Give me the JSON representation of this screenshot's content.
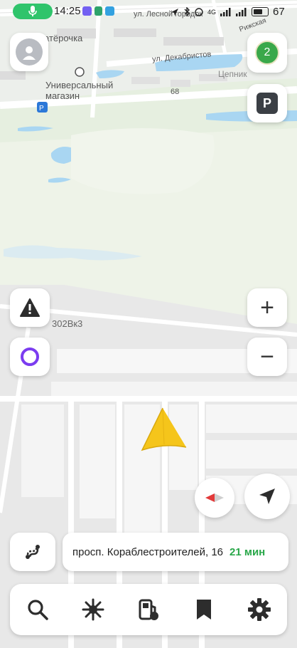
{
  "status_bar": {
    "time": "14:25",
    "network": "4G",
    "battery": "67"
  },
  "map": {
    "labels": {
      "shop": "Универсальный магазин",
      "pyaterochka": "атёрочка",
      "street_lesnoy": "ул. Лесной городок",
      "street_rizhskaya": "Рижская",
      "street_dekabristov": "ул. Декабристов",
      "tsepnik": "Цепник",
      "house_68": "68",
      "building_302": "302Вк3"
    }
  },
  "controls": {
    "notifications_count": "2",
    "parking_label": "P",
    "zoom_in": "+",
    "zoom_out": "−"
  },
  "route": {
    "destination": "просп. Кораблестроителей, 16",
    "eta": "21 мин"
  },
  "colors": {
    "accent_green": "#2aa84a",
    "arrow_yellow": "#f5c51b",
    "alice_purple": "#7b3cf0"
  },
  "tabbar": {
    "items": [
      "search-icon",
      "discovery-icon",
      "fuel-icon",
      "bookmarks-icon",
      "settings-icon"
    ]
  }
}
